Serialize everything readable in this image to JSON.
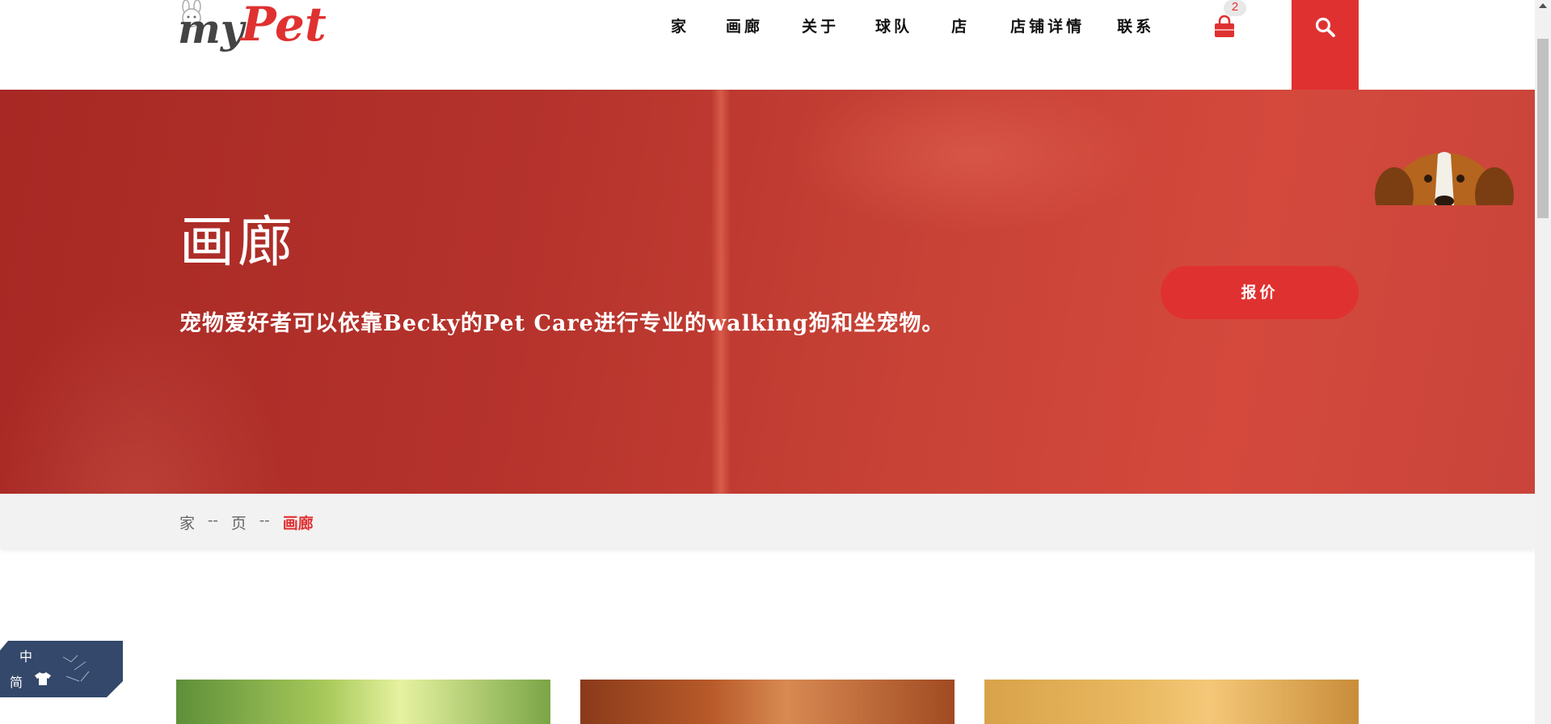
{
  "header": {
    "logo": {
      "word_1": "my",
      "word_2": "Pet"
    },
    "nav": [
      {
        "label": "家"
      },
      {
        "label": "画廊"
      },
      {
        "label": "关于"
      },
      {
        "label": "球队"
      },
      {
        "label": "店"
      },
      {
        "label": "店铺详情"
      },
      {
        "label": "联系"
      }
    ],
    "cart": {
      "icon": "shopping-bag-icon",
      "count": "2"
    },
    "search_icon": "search-icon"
  },
  "hero": {
    "title": "画廊",
    "subtitle": "宠物爱好者可以依靠Becky的Pet Care进行专业的walking狗和坐宠物。",
    "quote_button": "报价"
  },
  "breadcrumb": {
    "items": [
      "家",
      "--",
      "页",
      "--"
    ],
    "current": "画廊"
  },
  "language_widget": {
    "line_1": "中",
    "line_2": "简",
    "icon": "tshirt-icon"
  },
  "colors": {
    "accent": "#e03131",
    "hero": "#b8342c",
    "breadcrumb_bg": "#f2f2f2"
  }
}
